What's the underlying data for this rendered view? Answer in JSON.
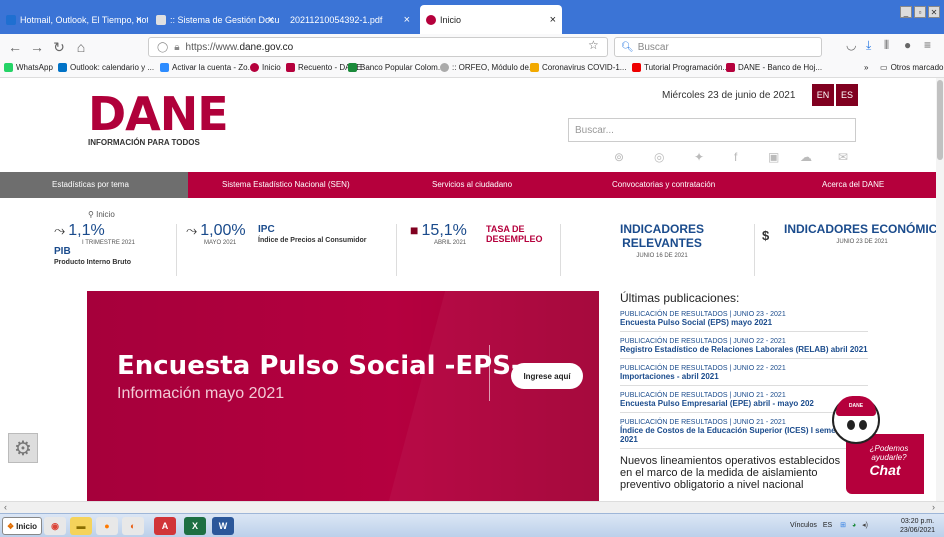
{
  "browser": {
    "tabs": [
      {
        "label": "Hotmail, Outlook, El Tiempo, noti",
        "close": "×"
      },
      {
        "label": ":: Sistema de Gestión Documenta",
        "close": "×"
      },
      {
        "label": "2021121005439​2-1.pdf",
        "close": "×"
      },
      {
        "label": "Inicio",
        "close": "×"
      }
    ],
    "url_prefix": "https://www.",
    "url_domain": "dane.gov.co",
    "search_placeholder": "Buscar",
    "bookmarks": [
      "WhatsApp",
      "Outlook: calendario y ...",
      "Activar la cuenta - Zo...",
      "Inicio",
      "Recuento - DANE",
      "Banco Popular Colom...",
      ":: ORFEO, Módulo de...",
      "Coronavirus COVID-1...",
      "Tutorial Programación...",
      "DANE - Banco de Hoj...",
      "»",
      "Otros marcadores"
    ]
  },
  "site": {
    "logo": "DANE",
    "tagline": "INFORMACIÓN PARA TODOS",
    "date": "Miércoles 23 de junio de 2021",
    "lang_en": "EN",
    "lang_es": "ES",
    "search_placeholder": "Buscar...",
    "menu": [
      "Estadísticas por tema",
      "Sistema Estadístico Nacional (SEN)",
      "Servicios al ciudadano",
      "Convocatorias y contratación",
      "Acerca del DANE"
    ],
    "breadcrumb": "Inicio"
  },
  "indicators": {
    "pib": {
      "value": "1,1%",
      "period": "I TRIMESTRE 2021",
      "title": "PIB",
      "desc": "Producto Interno Bruto"
    },
    "ipc": {
      "value": "1,00%",
      "period": "MAYO 2021",
      "title": "IPC",
      "desc": "Índice de Precios al Consumidor"
    },
    "desempleo": {
      "value": "15,1%",
      "period": "ABRIL 2021",
      "title_1": "TASA DE",
      "title_2": "DESEMPLEO"
    },
    "relevantes": {
      "title": "INDICADORES RELEVANTES",
      "date": "JUNIO 16 DE 2021"
    },
    "economicos": {
      "title": "INDICADORES ECONÓMICOS",
      "date": "JUNIO 23 DE 2021",
      "symbol": "$"
    }
  },
  "banner": {
    "title": "Encuesta Pulso Social -EPS-",
    "subtitle": "Información mayo 2021",
    "button": "Ingrese aquí"
  },
  "publications": {
    "heading": "Últimas publicaciones:",
    "items": [
      {
        "kind": "PUBLICACIÓN DE RESULTADOS | JUNIO 23 - 2021",
        "name": "Encuesta Pulso Social (EPS) mayo 2021"
      },
      {
        "kind": "PUBLICACIÓN DE RESULTADOS | JUNIO 22 - 2021",
        "name": "Registro Estadístico de Relaciones Laborales (RELAB) abril 2021"
      },
      {
        "kind": "PUBLICACIÓN DE RESULTADOS | JUNIO 22 - 2021",
        "name": "Importaciones - abril 2021"
      },
      {
        "kind": "PUBLICACIÓN DE RESULTADOS | JUNIO 21 - 2021",
        "name": "Encuesta Pulso Empresarial (EPE) abril - mayo 202"
      },
      {
        "kind": "PUBLICACIÓN DE RESULTADOS | JUNIO 21 - 2021",
        "name": "Índice de Costos de la Educación Superior (ICES) I semestre 2021"
      }
    ],
    "note": "Nuevos lineamientos operativos establecidos en el marco de la medida de aislamiento preventivo obligatorio a nivel nacional"
  },
  "chat": {
    "question": "¿Podemos ayudarle?",
    "label": "Chat",
    "mascot_cap": "DANE"
  },
  "taskbar": {
    "start": "Inicio",
    "tray_links": "Vínculos",
    "tray_lang": "ES",
    "time": "03:20 p.m.",
    "date": "23/06/2021"
  },
  "colors": {
    "brand": "#b5003c",
    "brand_dark": "#800020",
    "link": "#1a4b8c",
    "browser_tabbar": "#3b74d6"
  }
}
